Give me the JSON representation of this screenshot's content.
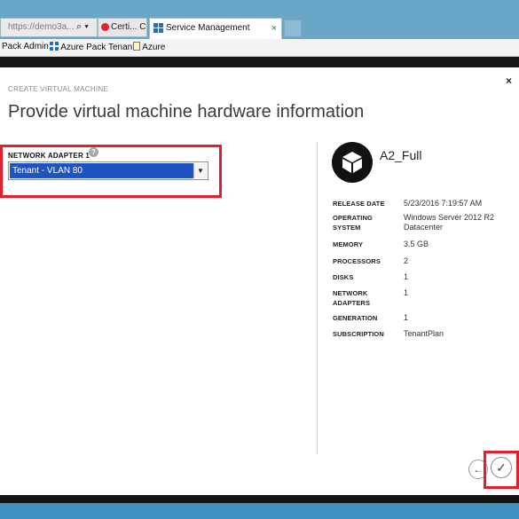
{
  "browser": {
    "address_text": "https://demo3a...",
    "address_tools": "⌕ ▾",
    "inactive_tab_label": "Certi... C",
    "active_tab_label": "Service Management",
    "active_tab_close": "×",
    "favorites": [
      "Pack Admin",
      "Azure Pack Tenant",
      "Azure"
    ]
  },
  "dialog": {
    "breadcrumb": "CREATE VIRTUAL MACHINE",
    "title": "Provide virtual machine hardware information",
    "close_glyph": "×",
    "network_adapter": {
      "label": "NETWORK ADAPTER 1",
      "help_glyph": "?",
      "selected_value": "Tenant - VLAN 80",
      "dropdown_glyph": "▼"
    },
    "vm": {
      "name": "A2_Full",
      "icon": "box-icon",
      "properties": [
        {
          "key": "RELEASE DATE",
          "value": "5/23/2016 7:19:57 AM"
        },
        {
          "key": "OPERATING SYSTEM",
          "value": "Windows Server 2012 R2 Datacenter"
        },
        {
          "key": "MEMORY",
          "value": "3.5 GB"
        },
        {
          "key": "PROCESSORS",
          "value": "2"
        },
        {
          "key": "DISKS",
          "value": "1"
        },
        {
          "key": "NETWORK ADAPTERS",
          "value": "1"
        },
        {
          "key": "GENERATION",
          "value": "1"
        },
        {
          "key": "SUBSCRIPTION",
          "value": "TenantPlan"
        }
      ]
    },
    "back_glyph": "←",
    "confirm_glyph": "✓"
  },
  "colors": {
    "highlight": "#e0202f",
    "selection": "#1f53c1",
    "taskbar": "#3f8fc0"
  }
}
